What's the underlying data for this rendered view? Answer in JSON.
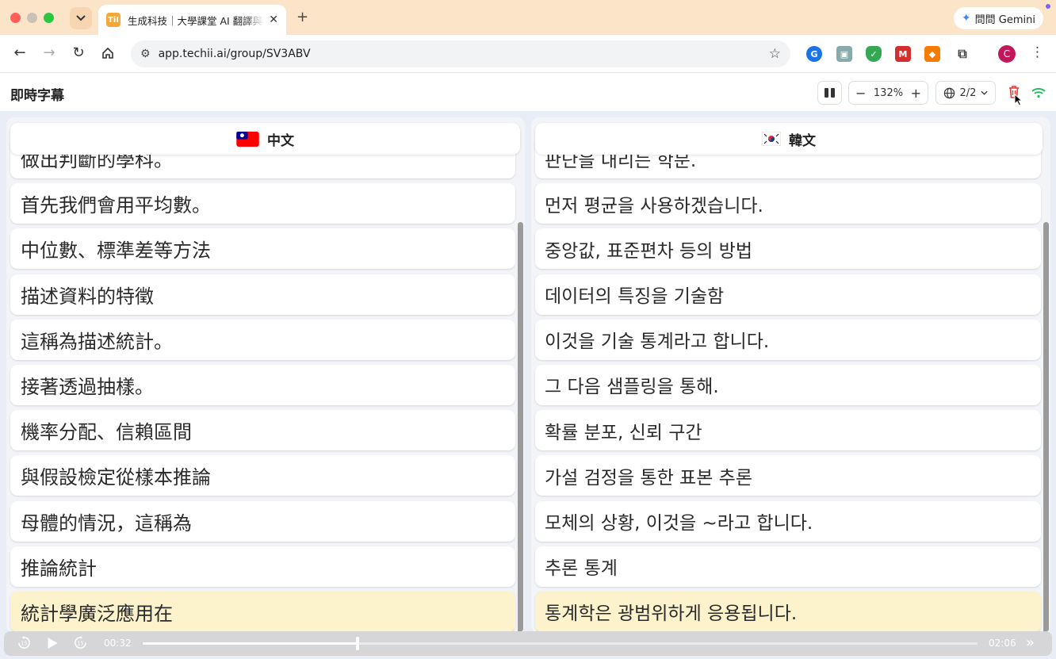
{
  "browser": {
    "tab_title": "生成科技｜大學課堂 AI 翻譯與字幕",
    "tab_favicon": "TiI",
    "url": "app.techii.ai/group/SV3ABV",
    "gemini_label": "問問 Gemini",
    "avatar_letter": "C"
  },
  "app": {
    "title": "即時字幕",
    "zoom": "132%",
    "lang_count": "2/2"
  },
  "left": {
    "language": "中文",
    "lines": [
      "做出判斷的學科。",
      "首先我們會用平均數。",
      "中位數、標準差等方法",
      "描述資料的特徵",
      "這稱為描述統計。",
      "接著透過抽樣。",
      "機率分配、信賴區間",
      "與假設檢定從樣本推論",
      "母體的情況，這稱為",
      "推論統計",
      "統計學廣泛應用在"
    ]
  },
  "right": {
    "language": "韓文",
    "lines": [
      "판단을 내리는 학문.",
      "먼저 평균을 사용하겠습니다.",
      "중앙값, 표준편차 등의 방법",
      "데이터의 특징을 기술함",
      "이것을 기술 통계라고 합니다.",
      "그 다음 샘플링을 통해.",
      "확률 분포, 신뢰 구간",
      "가설 검정을 통한 표본 추론",
      "모체의 상황, 이것을 ~라고 합니다.",
      "추론 통계",
      "통계학은 광범위하게 응용됩니다."
    ]
  },
  "player": {
    "current_time": "00:32",
    "duration": "02:06",
    "progress_fraction": 0.257
  },
  "colors": {
    "tabbar": "#fce4c8",
    "highlight_row": "#fcf3cd",
    "trash": "#e53935",
    "status_green": "#1db954"
  }
}
